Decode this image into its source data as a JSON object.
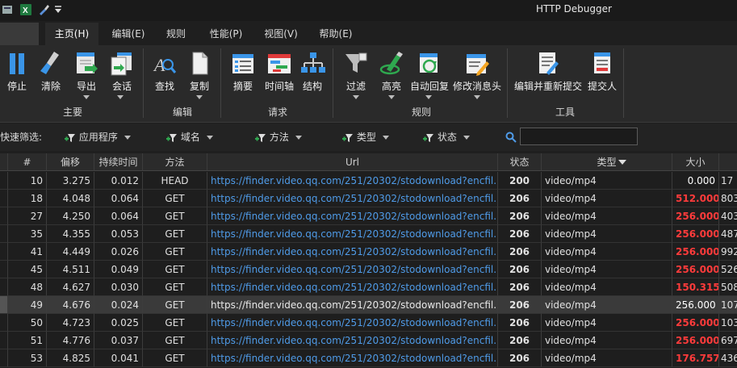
{
  "title": "HTTP Debugger",
  "quick_toolbar": {
    "icons": [
      "app-icon",
      "excel-icon",
      "brush-icon",
      "dropdown-icon"
    ]
  },
  "menu": [
    "主页(H)",
    "编辑(E)",
    "规则",
    "性能(P)",
    "视图(V)",
    "帮助(E)"
  ],
  "active_menu_index": 0,
  "ribbon": {
    "buttons": [
      {
        "label": "停止",
        "icon": "pause-icon"
      },
      {
        "label": "清除",
        "icon": "broom-icon"
      },
      {
        "label": "导出",
        "icon": "export-icon"
      },
      {
        "label": "会话",
        "icon": "session-icon"
      },
      {
        "label": "查找",
        "icon": "find-icon"
      },
      {
        "label": "复制",
        "icon": "copy-icon"
      },
      {
        "label": "摘要",
        "icon": "summary-icon"
      },
      {
        "label": "时间轴",
        "icon": "timeline-icon"
      },
      {
        "label": "结构",
        "icon": "structure-icon"
      },
      {
        "label": "过滤",
        "icon": "filter-icon"
      },
      {
        "label": "高亮",
        "icon": "highlight-icon"
      },
      {
        "label": "自动回复",
        "icon": "auto-reply-icon"
      },
      {
        "label": "修改消息头",
        "icon": "modify-header-icon"
      },
      {
        "label": "编辑并重新提交",
        "icon": "edit-resubmit-icon"
      },
      {
        "label": "提交人",
        "icon": "submitter-icon"
      }
    ],
    "groups": [
      "主要",
      "编辑",
      "请求",
      "规则",
      "工具"
    ]
  },
  "filter_bar": {
    "label": "快速筛选:",
    "items": [
      "应用程序",
      "域名",
      "方法",
      "类型",
      "状态"
    ],
    "search_value": ""
  },
  "colors": {
    "url": "#4f9be8",
    "size_red": "#ff3b3b",
    "bg": "#1f1f1f"
  },
  "table": {
    "columns": [
      "#",
      "偏移",
      "持续时间",
      "方法",
      "Url",
      "状态",
      "类型",
      "大小",
      ""
    ],
    "rows": [
      {
        "num": "10",
        "offset": "3.275",
        "duration": "0.012",
        "method": "HEAD",
        "url": "https://finder.video.qq.com/251/20302/stodownload?encfil...",
        "status": "200",
        "type": "video/mp4",
        "size": "0.000",
        "extra": "17"
      },
      {
        "num": "18",
        "offset": "4.048",
        "duration": "0.064",
        "method": "GET",
        "url": "https://finder.video.qq.com/251/20302/stodownload?encfil...",
        "status": "206",
        "type": "video/mp4",
        "size": "512.000",
        "extra": "803"
      },
      {
        "num": "27",
        "offset": "4.250",
        "duration": "0.064",
        "method": "GET",
        "url": "https://finder.video.qq.com/251/20302/stodownload?encfil...",
        "status": "206",
        "type": "video/mp4",
        "size": "256.000",
        "extra": "403"
      },
      {
        "num": "35",
        "offset": "4.355",
        "duration": "0.053",
        "method": "GET",
        "url": "https://finder.video.qq.com/251/20302/stodownload?encfil...",
        "status": "206",
        "type": "video/mp4",
        "size": "256.000",
        "extra": "487"
      },
      {
        "num": "41",
        "offset": "4.449",
        "duration": "0.026",
        "method": "GET",
        "url": "https://finder.video.qq.com/251/20302/stodownload?encfil...",
        "status": "206",
        "type": "video/mp4",
        "size": "256.000",
        "extra": "992"
      },
      {
        "num": "45",
        "offset": "4.511",
        "duration": "0.049",
        "method": "GET",
        "url": "https://finder.video.qq.com/251/20302/stodownload?encfil...",
        "status": "206",
        "type": "video/mp4",
        "size": "256.000",
        "extra": "526"
      },
      {
        "num": "48",
        "offset": "4.627",
        "duration": "0.030",
        "method": "GET",
        "url": "https://finder.video.qq.com/251/20302/stodownload?encfil...",
        "status": "206",
        "type": "video/mp4",
        "size": "150.315",
        "extra": "508"
      },
      {
        "num": "49",
        "offset": "4.676",
        "duration": "0.024",
        "method": "GET",
        "url": "https://finder.video.qq.com/251/20302/stodownload?encfil...",
        "status": "206",
        "type": "video/mp4",
        "size": "256.000",
        "extra": "107"
      },
      {
        "num": "50",
        "offset": "4.723",
        "duration": "0.025",
        "method": "GET",
        "url": "https://finder.video.qq.com/251/20302/stodownload?encfil...",
        "status": "206",
        "type": "video/mp4",
        "size": "256.000",
        "extra": "103"
      },
      {
        "num": "51",
        "offset": "4.776",
        "duration": "0.037",
        "method": "GET",
        "url": "https://finder.video.qq.com/251/20302/stodownload?encfil...",
        "status": "206",
        "type": "video/mp4",
        "size": "256.000",
        "extra": "697"
      },
      {
        "num": "53",
        "offset": "4.825",
        "duration": "0.041",
        "method": "GET",
        "url": "https://finder.video.qq.com/251/20302/stodownload?encfil...",
        "status": "206",
        "type": "video/mp4",
        "size": "176.757",
        "extra": "436"
      }
    ],
    "selected_row_index": 7
  }
}
